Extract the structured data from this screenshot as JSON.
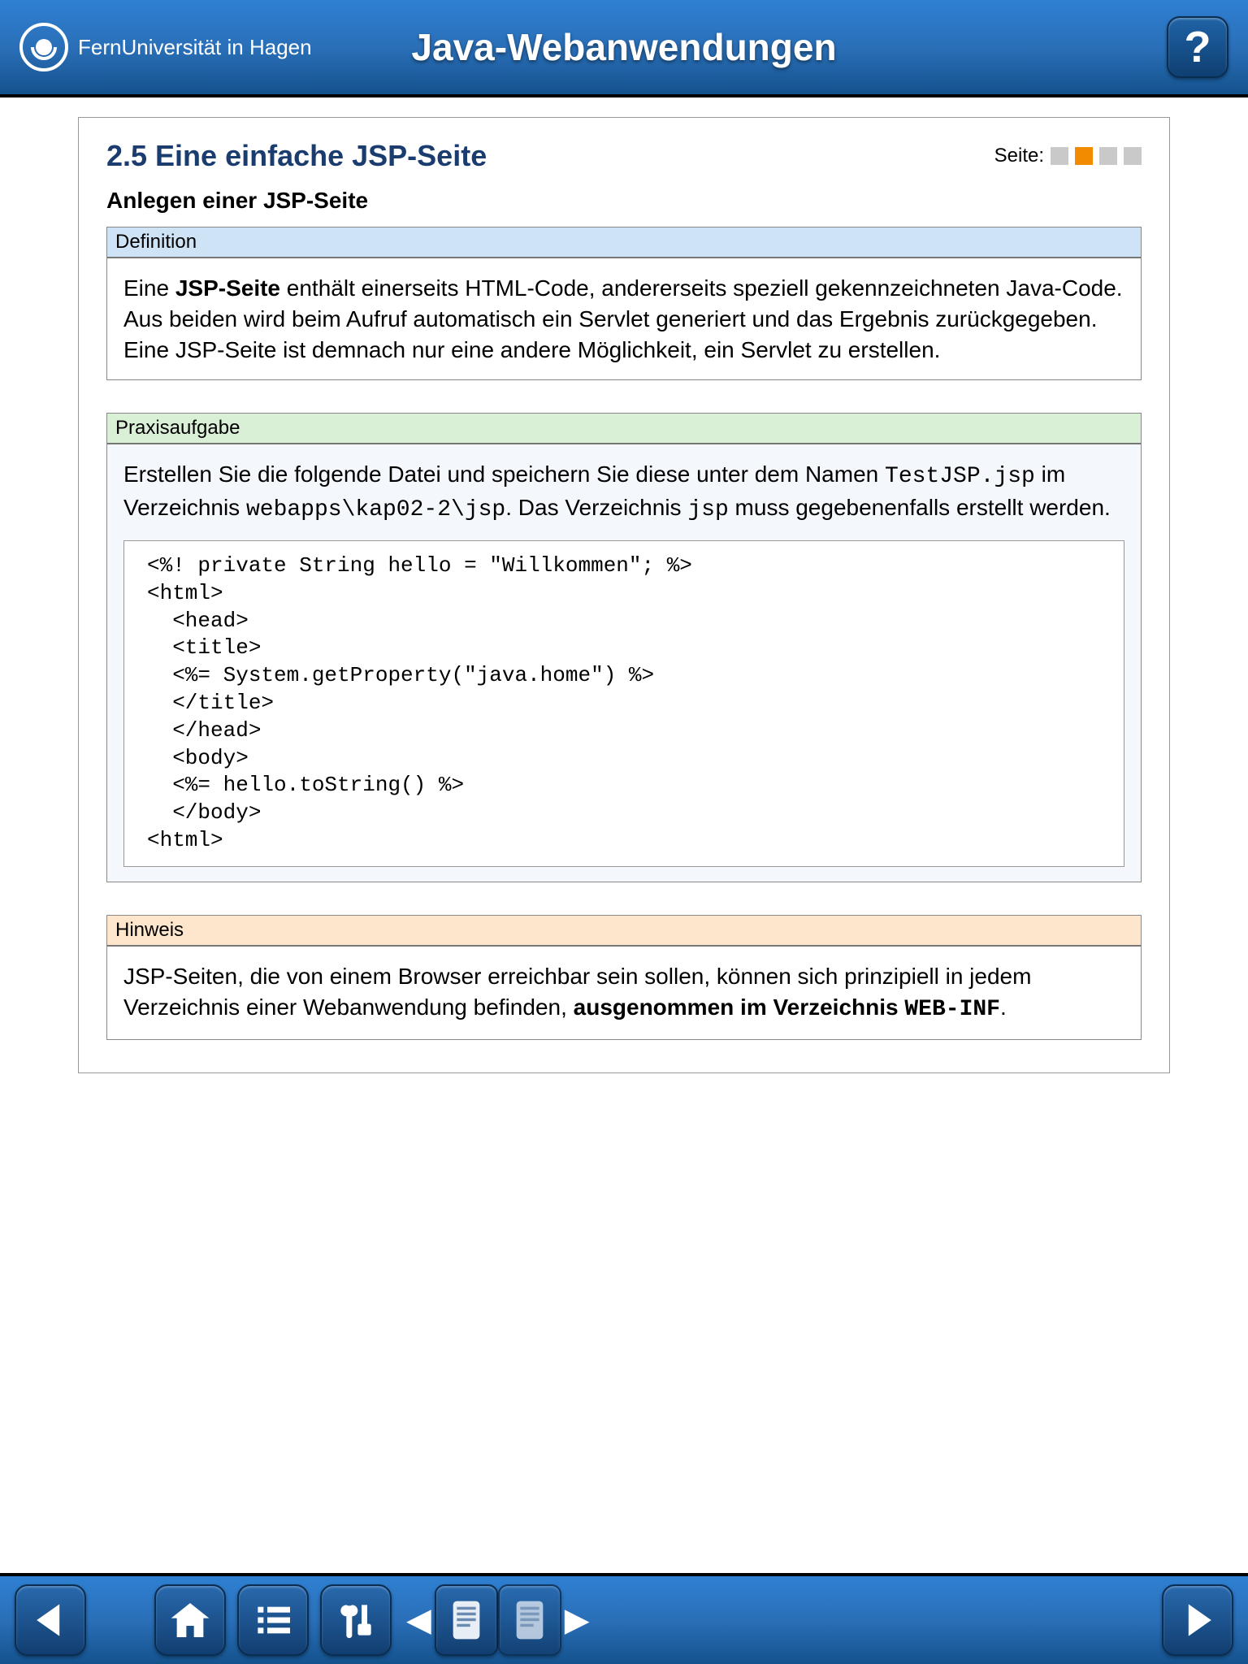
{
  "header": {
    "brand": "FernUniversität in Hagen",
    "title": "Java-Webanwendungen",
    "help_icon": "help-icon"
  },
  "pager": {
    "label": "Seite:",
    "total": 4,
    "active_index": 1
  },
  "chapter": "2.5 Eine einfache JSP-Seite",
  "subtitle": "Anlegen einer JSP-Seite",
  "definition": {
    "head": "Definition",
    "pre": "Eine ",
    "bold1": "JSP-Seite",
    "rest": " enthält einerseits HTML-Code, andererseits speziell gekennzeichneten Java-Code. Aus beiden wird beim Aufruf automatisch ein Servlet generiert und das Ergebnis zurückgegeben. Eine JSP-Seite ist demnach nur eine andere Möglichkeit, ein Servlet zu erstellen."
  },
  "task": {
    "head": "Praxisaufgabe",
    "t1": "Erstellen Sie die folgende Datei und speichern Sie diese unter dem Namen ",
    "file": "TestJSP.jsp",
    "t2": " im Verzeichnis ",
    "dir": "webapps\\kap02-2\\jsp",
    "t3": ". Das Verzeichnis ",
    "dir2": "jsp",
    "t4": " muss gegebenenfalls erstellt werden.",
    "code": "<%! private String hello = \"Willkommen\"; %>\n<html>\n  <head>\n  <title>\n  <%= System.getProperty(\"java.home\") %>\n  </title>\n  </head>\n  <body>\n  <%= hello.toString() %>\n  </body>\n<html>"
  },
  "hint": {
    "head": "Hinweis",
    "t1": "JSP-Seiten, die von einem Browser erreichbar sein sollen, können sich prinzipiell in jedem Verzeichnis einer Webanwendung befinden, ",
    "bold": "ausgenommen im Verzeichnis ",
    "mono": "WEB-INF",
    "t2": "."
  },
  "toolbar": {
    "prev": "prev-page",
    "home": "home",
    "toc": "table-of-contents",
    "tools": "tools",
    "doc_prev": "doc-prev",
    "doc_next": "doc-next",
    "next": "next-page"
  }
}
